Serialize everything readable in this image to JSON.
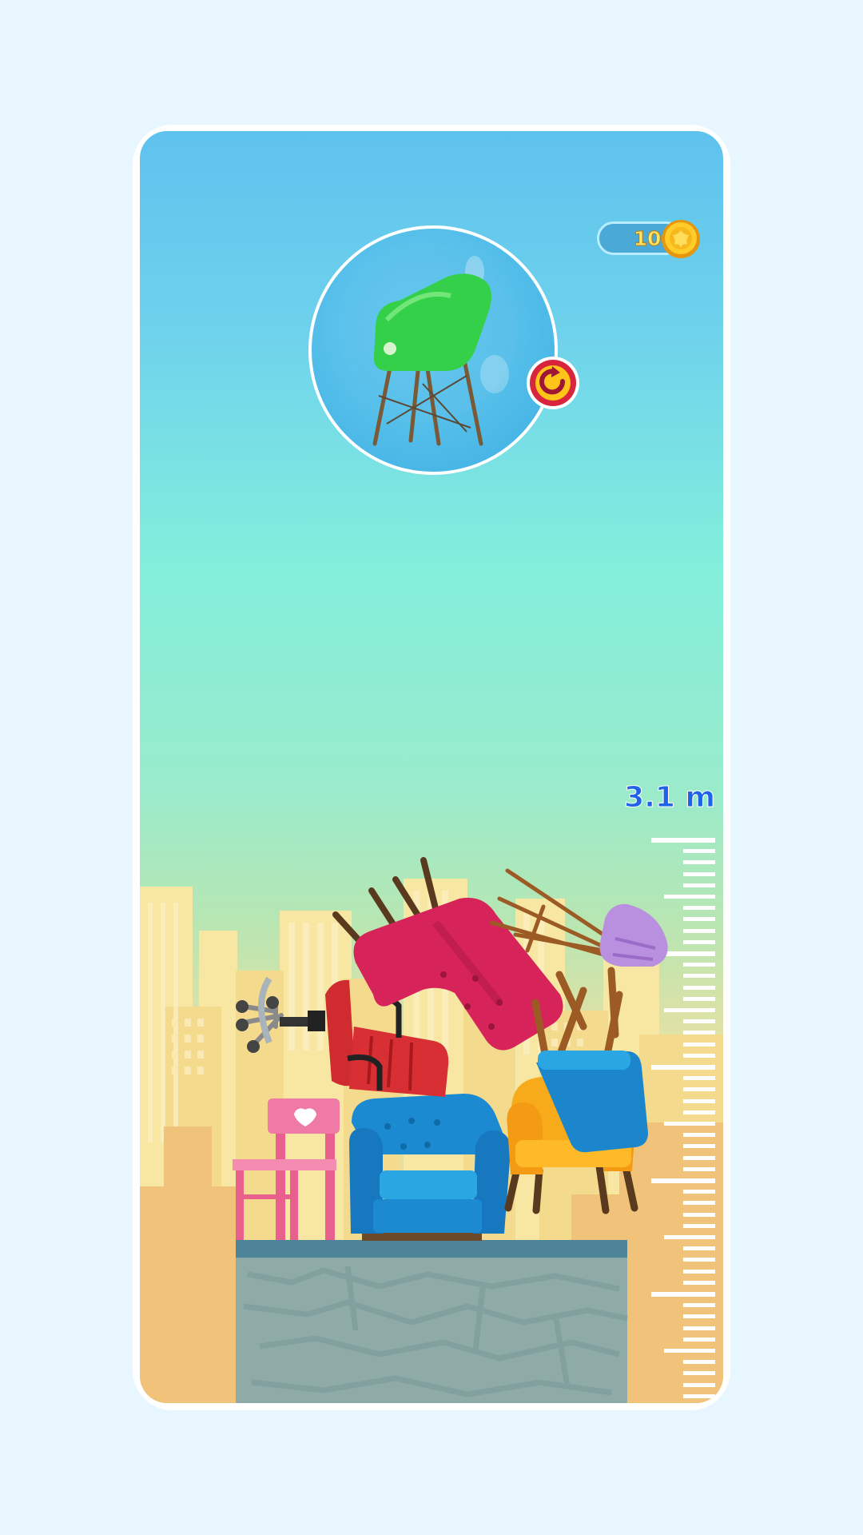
{
  "hud": {
    "coins": "10",
    "height_label": "3.1 m"
  },
  "next_piece": {
    "name": "green-plastic-chair",
    "rotate_icon": "rotate-icon"
  },
  "stack": [
    "pink-wooden-chair",
    "blue-armchair",
    "yellow-armchair",
    "red-office-chair",
    "pink-upholstered-chair",
    "blue-wooden-chair",
    "purple-chair"
  ],
  "colors": {
    "sky_top": "#5ec2ee",
    "sky_mid": "#82eedb",
    "accent_height": "#1f63e8",
    "coin_gold": "#f7b81c"
  }
}
